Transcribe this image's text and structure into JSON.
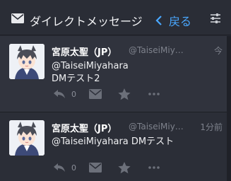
{
  "header": {
    "title": "ダイレクトメッセージ",
    "back_label": "戻る"
  },
  "messages": [
    {
      "name": "宮原太聖（JP）",
      "handle": "@TaiseiMiyahara",
      "time": "今",
      "text_lines": [
        "@TaiseiMiyahara",
        "DMテスト2"
      ],
      "reply_count": "0"
    },
    {
      "name": "宮原太聖（JP）",
      "handle": "@TaiseiMiyahara",
      "time": "1分前",
      "text_lines": [
        "@TaiseiMiyahara DMテスト"
      ],
      "reply_count": "0"
    }
  ],
  "colors": {
    "accent": "#4aa8ff",
    "background": "#272a33",
    "card": "#30333d",
    "muted": "#7e828c"
  },
  "icons": [
    "envelope-icon",
    "chevron-left-icon",
    "sliders-icon",
    "reply-icon",
    "envelope-icon",
    "star-icon",
    "more-icon"
  ]
}
